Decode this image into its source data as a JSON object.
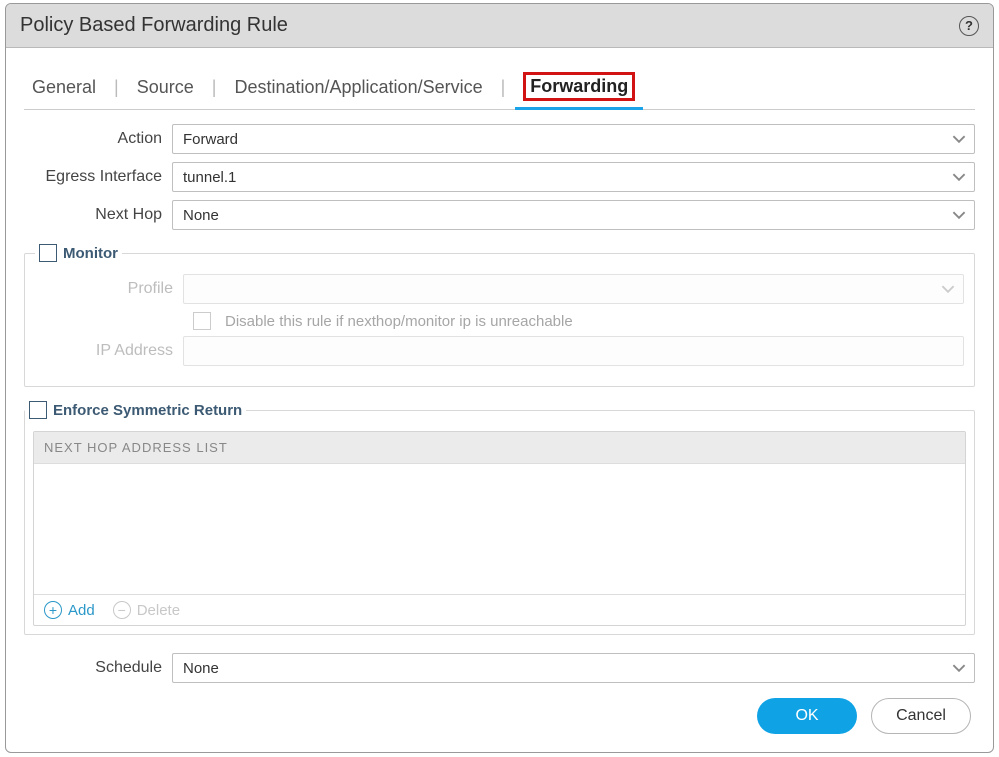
{
  "dialog": {
    "title": "Policy Based Forwarding Rule"
  },
  "tabs": {
    "general": "General",
    "source": "Source",
    "dest": "Destination/Application/Service",
    "forwarding": "Forwarding"
  },
  "fields": {
    "action_label": "Action",
    "action_value": "Forward",
    "egress_label": "Egress Interface",
    "egress_value": "tunnel.1",
    "nexthop_label": "Next Hop",
    "nexthop_value": "None",
    "schedule_label": "Schedule",
    "schedule_value": "None"
  },
  "monitor": {
    "legend": "Monitor",
    "profile_label": "Profile",
    "disable_text": "Disable this rule if nexthop/monitor ip is unreachable",
    "ip_label": "IP Address"
  },
  "symret": {
    "legend": "Enforce Symmetric Return",
    "list_header": "NEXT HOP ADDRESS LIST",
    "add_label": "Add",
    "delete_label": "Delete"
  },
  "buttons": {
    "ok": "OK",
    "cancel": "Cancel"
  }
}
